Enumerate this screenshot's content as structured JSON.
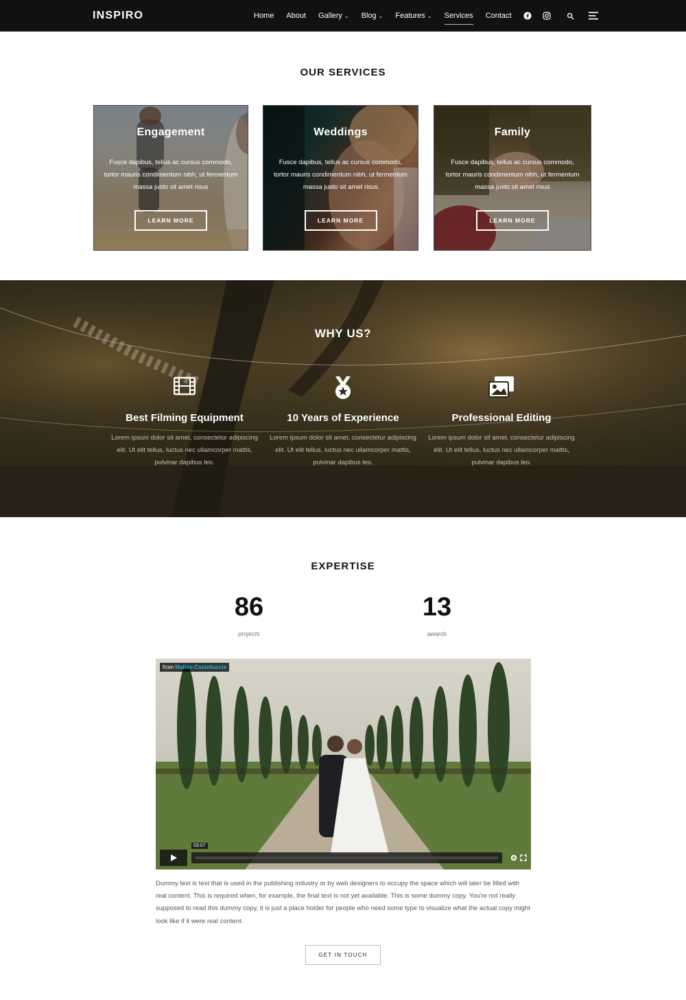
{
  "nav": {
    "logo": "INSPIRO",
    "items": [
      {
        "label": "Home"
      },
      {
        "label": "About"
      },
      {
        "label": "Gallery",
        "caret": "⌄"
      },
      {
        "label": "Blog",
        "caret": "⌄"
      },
      {
        "label": "Features",
        "caret": "⌄"
      },
      {
        "label": "Services"
      },
      {
        "label": "Contact"
      }
    ],
    "active": "Services",
    "icons": [
      "facebook-icon",
      "instagram-icon",
      "search-icon",
      "menu-icon"
    ]
  },
  "services": {
    "title": "OUR SERVICES",
    "cards": [
      {
        "title": "Engagement",
        "text": "Fusce dapibus, tellus ac cursus commodo, tortor mauris condimentum nibh, ut fermentum massa justo sit amet risus",
        "button": "LEARN MORE"
      },
      {
        "title": "Weddings",
        "text": "Fusce dapibus, tellus ac cursus commodo, tortor mauris condimentum nibh, ut fermentum massa justo sit amet risus",
        "button": "LEARN MORE"
      },
      {
        "title": "Family",
        "text": "Fusce dapibus, tellus ac cursus commodo, tortor mauris condimentum nibh, ut fermentum massa justo sit amet risus",
        "button": "LEARN MORE"
      }
    ]
  },
  "why": {
    "title": "WHY US?",
    "features": [
      {
        "icon": "film-icon",
        "title": "Best Filming Equipment",
        "text": "Lorem ipsum dolor sit amet, consectetur adipiscing elit. Ut elit tellus, luctus nec ullamcorper mattis, pulvinar dapibus leo."
      },
      {
        "icon": "medal-icon",
        "title": "10 Years of Experience",
        "text": "Lorem ipsum dolor sit amet, consectetur adipiscing elit. Ut elit tellus, luctus nec ullamcorper mattis, pulvinar dapibus leo."
      },
      {
        "icon": "photos-icon",
        "title": "Professional Editing",
        "text": "Lorem ipsum dolor sit amet, consectetur adipiscing elit. Ut elit tellus, luctus nec ullamcorper mattis, pulvinar dapibus leo."
      }
    ]
  },
  "expertise": {
    "title": "EXPERTISE",
    "stats": [
      {
        "value": "86",
        "label": "projects"
      },
      {
        "value": "13",
        "label": "awards"
      }
    ]
  },
  "video": {
    "badge_prefix": "from",
    "badge_author": "Matteo Castelluccia",
    "time": "03:07"
  },
  "paragraph": "Dummy text is text that is used in the publishing industry or by web designers to occupy the space which will later be filled with real content. This is required when, for example, the final text is not yet available. This is some dummy copy. You're not really supposed to read this dummy copy, it is just a place holder for people who need some type to visualize what the actual copy might look like if it were real content.",
  "cta": "GET IN TOUCH",
  "colors": {
    "nav_bg": "#111111",
    "vimeo_accent": "#1ab7ea"
  }
}
